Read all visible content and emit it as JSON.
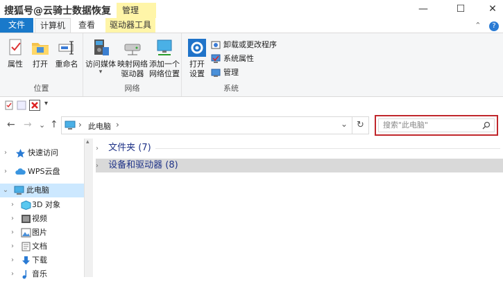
{
  "title_bar": {
    "watermark": "搜狐号@云骑士数据恢复",
    "context_tab": "管理",
    "minimize": "—",
    "maximize": "☐",
    "close": "✕"
  },
  "tabs": [
    {
      "label": "文件"
    },
    {
      "label": "计算机"
    },
    {
      "label": "查看"
    },
    {
      "label": "驱动器工具"
    }
  ],
  "tab_extras": {
    "collapse": "⌃",
    "help": "?"
  },
  "ribbon": {
    "groups": [
      {
        "label": "位置",
        "buttons": [
          "属性",
          "打开",
          "重命名"
        ]
      },
      {
        "label": "网络",
        "buttons": [
          "访问媒体",
          "映射网络\n驱动器",
          "添加一个\n网络位置"
        ]
      },
      {
        "label": "系统",
        "buttons": [
          "打开\n设置"
        ],
        "small_items": [
          "卸载或更改程序",
          "系统属性",
          "管理"
        ]
      }
    ],
    "dropdown_marker": "▾"
  },
  "qat": {
    "dropdown": "▾"
  },
  "address": {
    "back": "←",
    "forward": "→",
    "recent": "⌄",
    "up": "↑",
    "separator": "›",
    "location": "此电脑",
    "trail_sep": "›",
    "dropdown": "⌄",
    "refresh": "↻"
  },
  "search": {
    "placeholder": "搜索\"此电脑\"",
    "icon_glyph": "⌕"
  },
  "nav_pane": {
    "items": [
      {
        "label": "快速访问",
        "expanded": false,
        "level": 0
      },
      {
        "label": "WPS云盘",
        "expanded": false,
        "level": 0
      },
      {
        "label": "此电脑",
        "expanded": true,
        "level": 0,
        "selected": true
      },
      {
        "label": "3D 对象",
        "level": 1
      },
      {
        "label": "视频",
        "level": 1
      },
      {
        "label": "图片",
        "level": 1
      },
      {
        "label": "文档",
        "level": 1
      },
      {
        "label": "下载",
        "level": 1
      },
      {
        "label": "音乐",
        "level": 1
      }
    ],
    "chevron_right": "›",
    "chevron_down": "⌄",
    "scroll_up": "▴"
  },
  "content": {
    "groups": [
      {
        "label": "文件夹 (7)",
        "highlighted": false
      },
      {
        "label": "设备和驱动器 (8)",
        "highlighted": true
      }
    ],
    "chevron": "›"
  },
  "colors": {
    "file_tab": "#1979ca",
    "context_tab": "#fff5a8",
    "search_highlight": "#c0262b",
    "arrow": "#b22828",
    "selected_nav": "#cce8ff",
    "group_text": "#1e3287"
  }
}
